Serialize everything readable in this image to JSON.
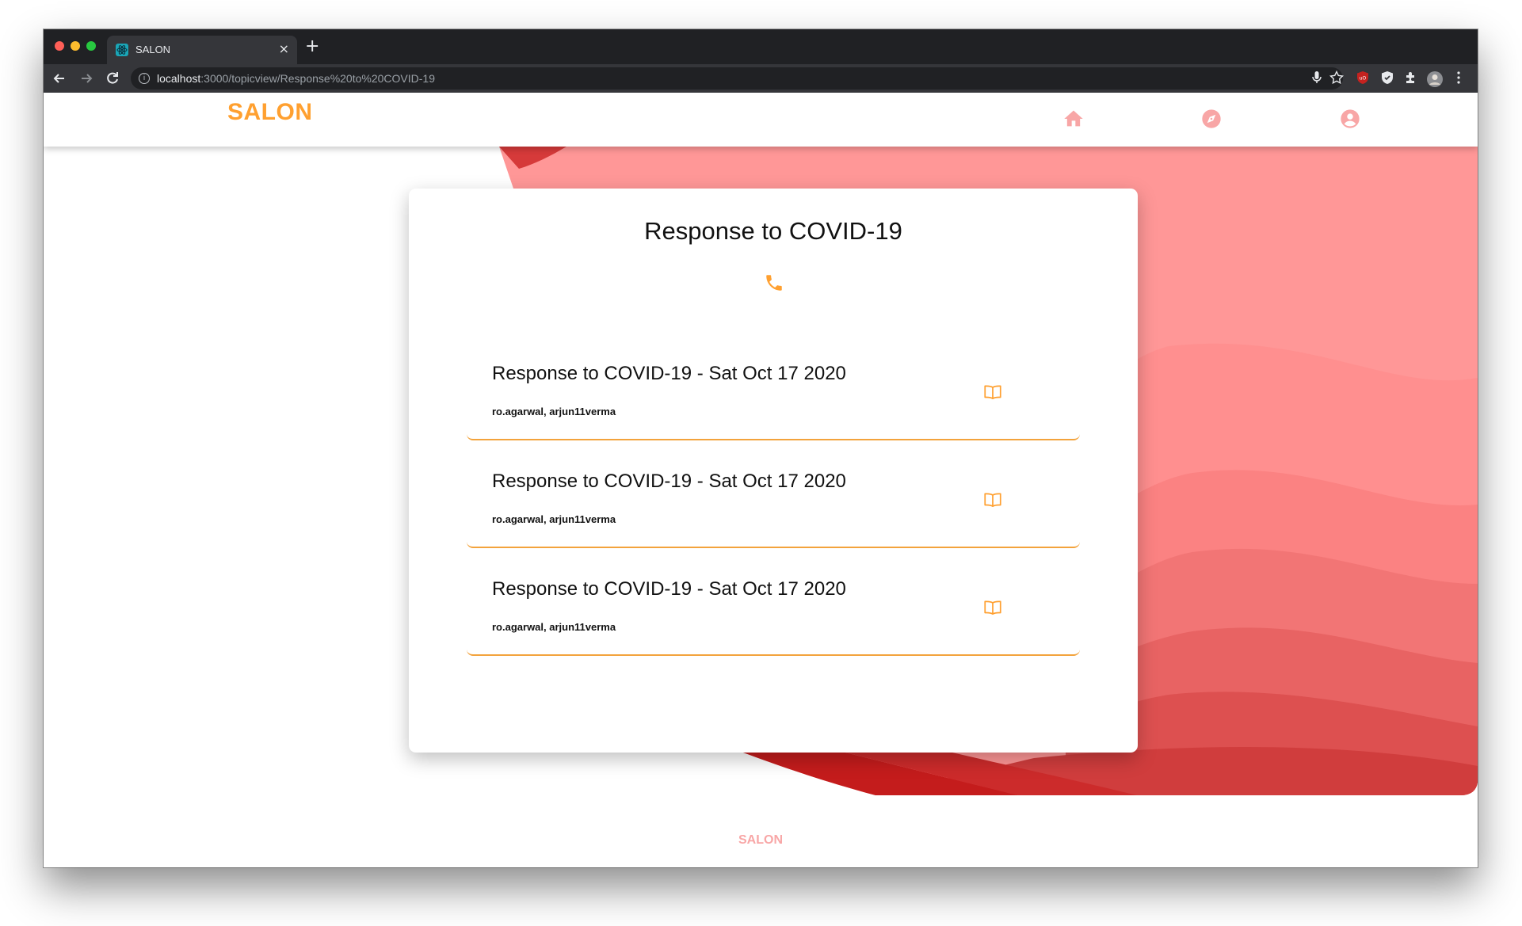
{
  "browser": {
    "tab_title": "SALON",
    "close_glyph": "×",
    "new_tab_glyph": "+",
    "url_host": "localhost",
    "url_rest": ":3000/topicview/Response%20to%20COVID-19",
    "icons": [
      "back-icon",
      "forward-icon",
      "reload-icon",
      "info-icon",
      "mic-icon",
      "star-icon",
      "ublock-icon",
      "shield-icon",
      "extensions-icon",
      "profile-avatar",
      "menu-icon"
    ]
  },
  "navbar": {
    "brand": "SALON",
    "icons": [
      "home-icon",
      "explore-compass-icon",
      "account-circle-icon"
    ]
  },
  "topic": {
    "title": "Response to COVID-19",
    "icon": "phone-icon"
  },
  "entries": [
    {
      "title": "Response to COVID-19 - Sat Oct 17 2020",
      "authors": "ro.agarwal, arjun11verma",
      "icon": "book-open-icon"
    },
    {
      "title": "Response to COVID-19 - Sat Oct 17 2020",
      "authors": "ro.agarwal, arjun11verma",
      "icon": "book-open-icon"
    },
    {
      "title": "Response to COVID-19 - Sat Oct 17 2020",
      "authors": "ro.agarwal, arjun11verma",
      "icon": "book-open-icon"
    }
  ],
  "footer": {
    "brand": "SALON"
  },
  "colors": {
    "brand_orange": "#ffa030",
    "accent_pink": "#f8a6a6",
    "wave_light": "#ff9797",
    "wave_dark": "#c41c1c"
  }
}
